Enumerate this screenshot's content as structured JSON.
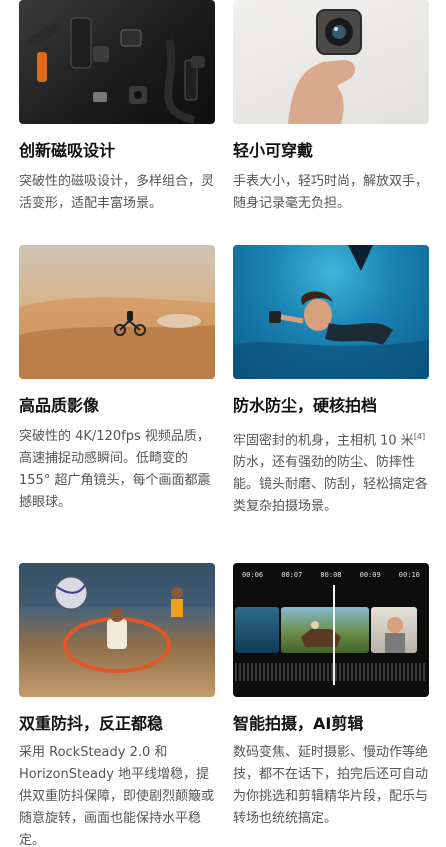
{
  "features": [
    {
      "title": "创新磁吸设计",
      "desc": "突破性的磁吸设计，多样组合，灵活变形，适配丰富场景。"
    },
    {
      "title": "轻小可穿戴",
      "desc": "手表大小，轻巧时尚，解放双手，随身记录毫无负担。"
    },
    {
      "title": "高品质影像",
      "desc": "突破性的 4K/120fps 视频品质，高速捕捉动感瞬间。低畸变的 155° 超广角镜头，每个画面都震撼眼球。"
    },
    {
      "title": "防水防尘，硬核拍档",
      "desc_pre": "牢固密封的机身，主相机 10 米",
      "desc_sup": "[4]",
      "desc_post": "防水，还有强劲的防尘、防摔性能。镜头耐磨、防刮，轻松搞定各类复杂拍摄场景。"
    },
    {
      "title": "双重防抖，反正都稳",
      "desc": "采用 RockSteady 2.0 和 HorizonSteady 地平线增稳，提供双重防抖保障，即使剧烈颠簸或随意旋转，画面也能保持水平稳定。"
    },
    {
      "title": "智能拍摄，AI剪辑",
      "desc": "数码变焦、延时摄影、慢动作等绝技，都不在话下，拍完后还可自动为你挑选和剪辑精华片段，配乐与转场也统统搞定。"
    }
  ],
  "editor": {
    "timestamps": [
      "00:06",
      "00:07",
      "00:08",
      "00:09",
      "00:10"
    ]
  }
}
